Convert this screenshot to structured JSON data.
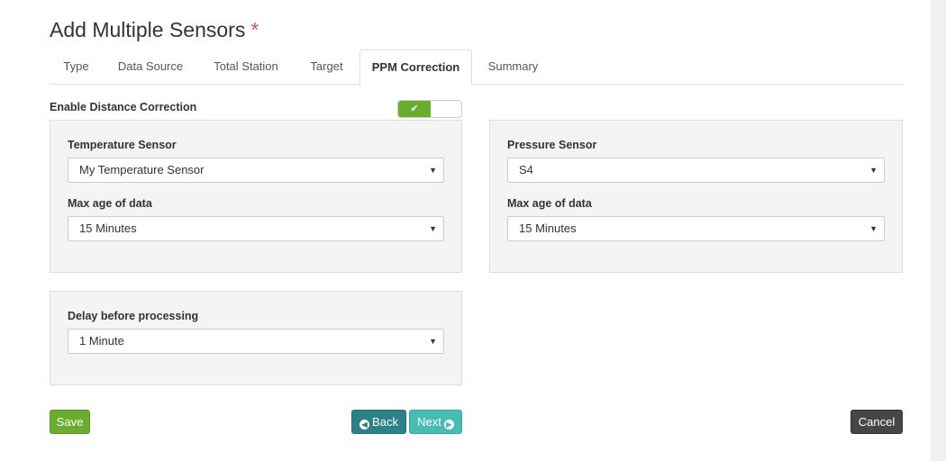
{
  "page": {
    "title": "Add Multiple Sensors",
    "required_marker": "*"
  },
  "tabs": [
    {
      "label": "Type",
      "active": false
    },
    {
      "label": "Data Source",
      "active": false
    },
    {
      "label": "Total Station",
      "active": false
    },
    {
      "label": "Target",
      "active": false
    },
    {
      "label": "PPM Correction",
      "active": true
    },
    {
      "label": "Summary",
      "active": false
    }
  ],
  "distance_correction": {
    "label": "Enable Distance Correction",
    "enabled": true,
    "toggle_icon": "check-icon"
  },
  "temperature": {
    "sensor_label": "Temperature Sensor",
    "sensor_value": "My Temperature Sensor",
    "age_label": "Max age of data",
    "age_value": "15 Minutes"
  },
  "pressure": {
    "sensor_label": "Pressure Sensor",
    "sensor_value": "S4",
    "age_label": "Max age of data",
    "age_value": "15 Minutes"
  },
  "delay": {
    "label": "Delay before processing",
    "value": "1 Minute"
  },
  "buttons": {
    "save": "Save",
    "back": "Back",
    "next": "Next",
    "cancel": "Cancel"
  },
  "colors": {
    "save": "#6aad2e",
    "back": "#2c8088",
    "next": "#47bcb5",
    "cancel": "#464646",
    "required": "#d9534f"
  }
}
